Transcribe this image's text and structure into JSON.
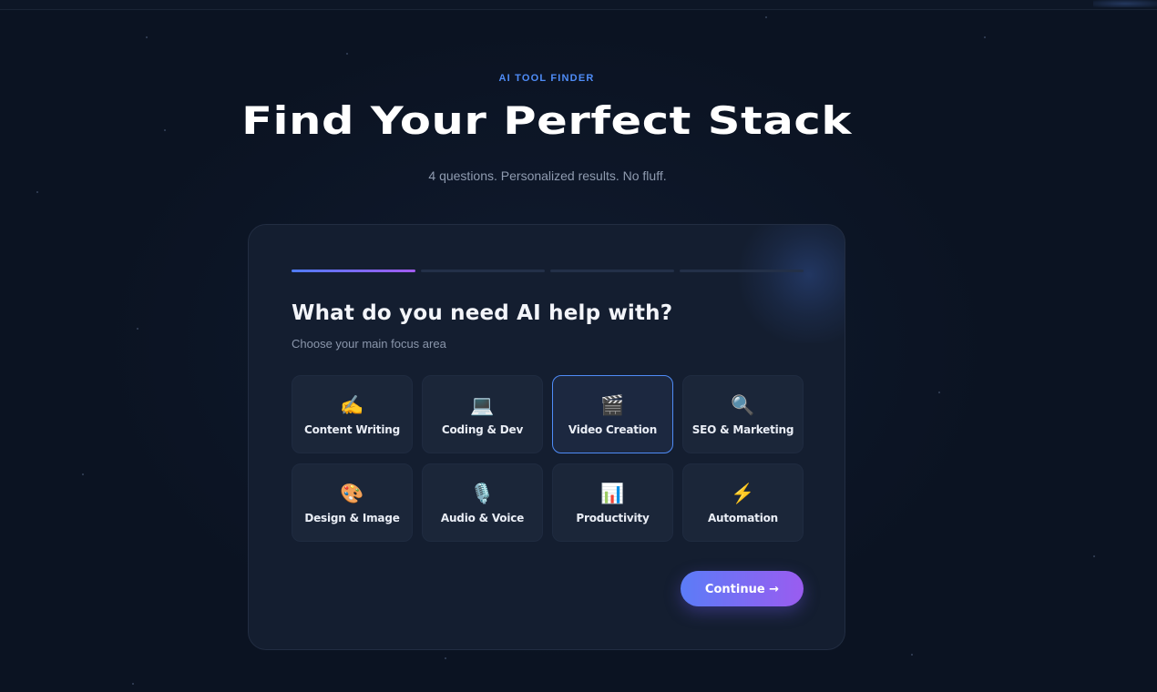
{
  "header": {
    "eyebrow": "AI TOOL FINDER",
    "title": "Find Your Perfect Stack",
    "subtitle": "4 questions. Personalized results. No fluff."
  },
  "progress": {
    "current_step": 1,
    "total_steps": 4
  },
  "quiz": {
    "question": "What do you need AI help with?",
    "hint": "Choose your main focus area",
    "selected": "Video Creation",
    "options": [
      {
        "label": "Content Writing",
        "icon": "✍️",
        "icon_name": "writing-hand-icon"
      },
      {
        "label": "Coding & Dev",
        "icon": "💻",
        "icon_name": "laptop-icon"
      },
      {
        "label": "Video Creation",
        "icon": "🎬",
        "icon_name": "clapperboard-icon"
      },
      {
        "label": "SEO & Marketing",
        "icon": "🔍",
        "icon_name": "magnifier-icon"
      },
      {
        "label": "Design & Image",
        "icon": "🎨",
        "icon_name": "palette-icon"
      },
      {
        "label": "Audio & Voice",
        "icon": "🎙️",
        "icon_name": "microphone-icon"
      },
      {
        "label": "Productivity",
        "icon": "📊",
        "icon_name": "bar-chart-icon"
      },
      {
        "label": "Automation",
        "icon": "⚡",
        "icon_name": "lightning-icon"
      }
    ],
    "continue_label": "Continue →"
  },
  "colors": {
    "background": "#0b1322",
    "card": "#141e30",
    "accent_blue": "#4f8cf7",
    "accent_purple": "#a25bf0"
  }
}
